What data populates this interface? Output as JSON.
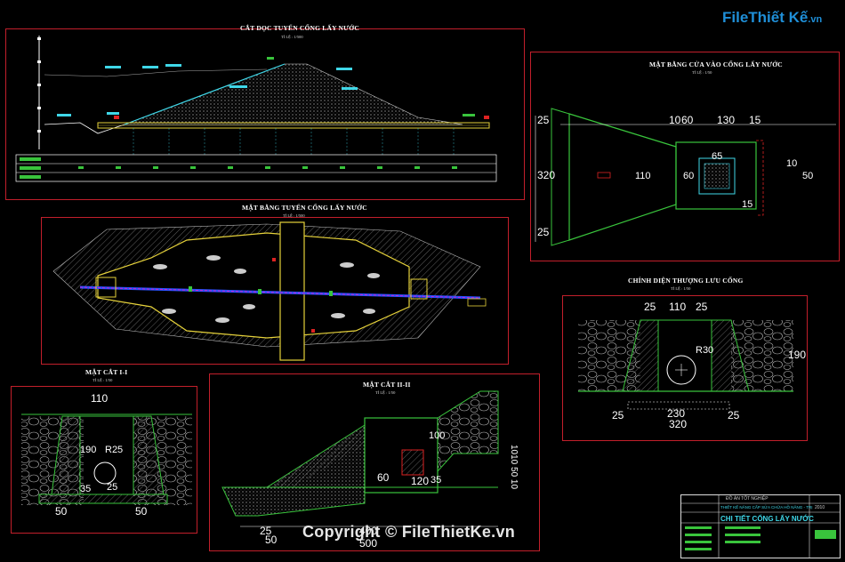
{
  "logo": {
    "text": "FileThiết Kế",
    "domain": ".vn"
  },
  "copyright": "Copyright © FileThietKe.vn",
  "panels": {
    "longitudinal": {
      "title": "CẮT DỌC TUYẾN CỐNG LẤY NƯỚC",
      "scale": "TỈ LỆ : 1/500"
    },
    "plan": {
      "title": "MẶT BẰNG TUYẾN CỐNG LẤY NƯỚC",
      "scale": "TỈ LỆ : 1/500"
    },
    "inlet": {
      "title": "MẶT BẰNG CỬA VÀO CỐNG LẤY NƯỚC",
      "scale": "TỈ LỆ : 1/50"
    },
    "upstream": {
      "title": "CHÍNH DIỆN THƯỢNG LƯU CỐNG",
      "scale": "TỈ LỆ : 1/50"
    },
    "section1": {
      "title": "MẶT CẮT I-I",
      "scale": "TỈ LỆ : 1/50"
    },
    "section2": {
      "title": "MẶT CẮT II-II",
      "scale": "TỈ LỆ : 1/50"
    }
  },
  "inlet_dims": {
    "d10": "10",
    "d60": "60",
    "d130": "130",
    "d15": "15",
    "d25a": "25",
    "d320": "320",
    "d25b": "25",
    "d110": "110",
    "d60b": "60",
    "d65": "65",
    "d50": "50",
    "d10b": "10",
    "d15b": "15"
  },
  "upstream_dims": {
    "d25a": "25",
    "d110": "110",
    "d25b": "25",
    "d190": "190",
    "r30": "R30",
    "d25c": "25",
    "d230": "230",
    "d25d": "25",
    "d320": "320"
  },
  "section1_dims": {
    "d110": "110",
    "d190": "190",
    "r25": "R25",
    "d35": "35",
    "d50a": "50",
    "d50b": "50",
    "d25": "25"
  },
  "section2_dims": {
    "d60": "60",
    "d120": "120",
    "d100": "100",
    "d35": "35",
    "d25": "25",
    "d50": "50",
    "d400": "400",
    "d500": "500",
    "side": "1010 50 10"
  },
  "title_block": {
    "drawing_title": "CHI TIẾT CỐNG LẤY NƯỚC",
    "project": "THIẾT KẾ NÂNG CẤP SỬA CHỮA HỒ NÂNG - TRỊ",
    "header": "ĐỒ ÁN TỐT NGHIỆP",
    "sheet": "2010"
  },
  "colors": {
    "frame": "#c21f2b",
    "cyan": "#3fd7e8",
    "yellow": "#e6d23a",
    "green": "#39c43c",
    "blue": "#2a52ff",
    "magenta": "#d01fd0"
  }
}
